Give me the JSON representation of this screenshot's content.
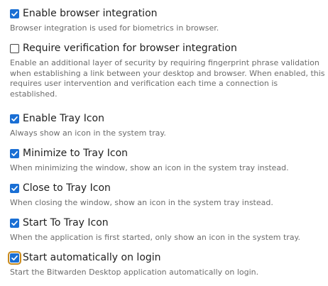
{
  "settings": {
    "items": [
      {
        "label": "Enable browser integration",
        "description": "Browser integration is used for biometrics in browser.",
        "checked": true
      },
      {
        "label": "Require verification for browser integration",
        "description": "Enable an additional layer of security by requiring fingerprint phrase validation when establishing a link between your desktop and browser. When enabled, this requires user intervention and verification each time a connection is established.",
        "checked": false
      },
      {
        "label": "Enable Tray Icon",
        "description": "Always show an icon in the system tray.",
        "checked": true
      },
      {
        "label": "Minimize to Tray Icon",
        "description": "When minimizing the window, show an icon in the system tray instead.",
        "checked": true
      },
      {
        "label": "Close to Tray Icon",
        "description": "When closing the window, show an icon in the system tray instead.",
        "checked": true
      },
      {
        "label": "Start To Tray Icon",
        "description": "When the application is first started, only show an icon in the system tray.",
        "checked": true
      },
      {
        "label": "Start automatically on login",
        "description": "Start the Bitwarden Desktop application automatically on login.",
        "checked": true
      }
    ]
  },
  "colors": {
    "checkbox_checked": "#1a6fd4",
    "focus_ring": "#c98a1c",
    "label_text": "#1f1f1f",
    "description_text": "#6c6c6c"
  },
  "icons": {
    "check": "checkmark-icon"
  }
}
